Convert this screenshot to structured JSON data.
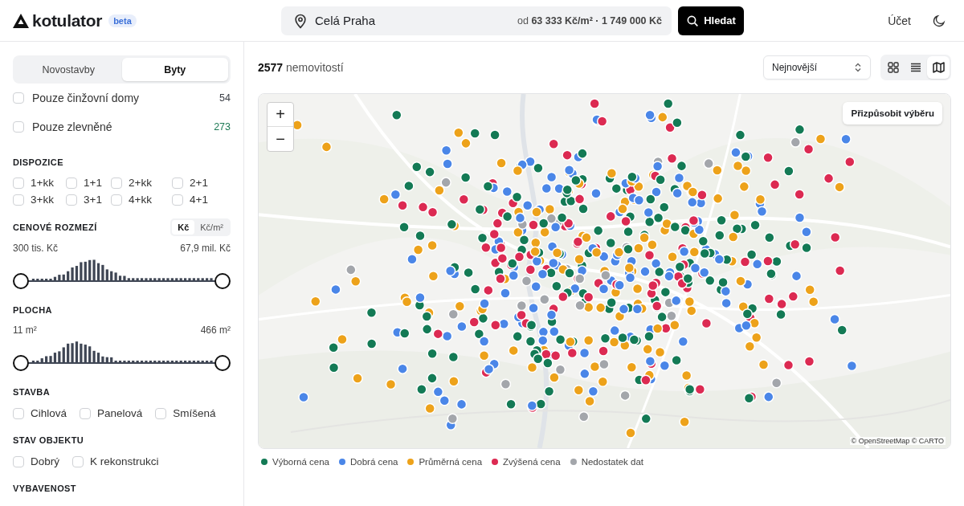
{
  "header": {
    "logo": "kotulator",
    "badge": "beta",
    "search": {
      "value": "Celá Praha",
      "price_info": "od **63 333 Kč/m² · 1 749 000 Kč**"
    },
    "search_button": "Hledat",
    "account": "Účet"
  },
  "sidebar": {
    "tabs": [
      {
        "label": "Novostavby",
        "selected": false
      },
      {
        "label": "Byty",
        "selected": true
      }
    ],
    "toggles": [
      {
        "label": "Pouze činžovní domy",
        "count": "54",
        "checked": false,
        "color": "#3b3f46"
      },
      {
        "label": "Pouze zlevněné",
        "count": "273",
        "checked": false,
        "color": "#1d7a55"
      }
    ],
    "sections": [
      {
        "kind": "grid",
        "title": "DISPOZICE",
        "options": [
          {
            "label": "1+kk",
            "checked": false
          },
          {
            "label": "1+1",
            "checked": false
          },
          {
            "label": "2+kk",
            "checked": false
          },
          {
            "label": "2+1",
            "checked": false
          },
          {
            "label": "3+kk",
            "checked": false
          },
          {
            "label": "3+1",
            "checked": false
          },
          {
            "label": "4+kk",
            "checked": false
          },
          {
            "label": "4+1",
            "checked": false
          }
        ]
      },
      {
        "kind": "range",
        "title": "CENOVÉ ROZMEZÍ",
        "units": [
          {
            "label": "Kč",
            "selected": true
          },
          {
            "label": "Kč/m²",
            "selected": false
          }
        ],
        "min_label": "300 tis. Kč",
        "max_label": "67,9 mil. Kč",
        "thumbs": [
          {
            "level": 0
          },
          {
            "level": 1
          }
        ]
      },
      {
        "kind": "range",
        "title": "PLOCHA",
        "min_label": "11 m²",
        "max_label": "466 m²",
        "thumbs": [
          {
            "level": 0
          },
          {
            "level": 1
          }
        ]
      },
      {
        "kind": "row",
        "title": "STAVBA",
        "options": [
          {
            "label": "Cihlová",
            "checked": false
          },
          {
            "label": "Panelová",
            "checked": false
          },
          {
            "label": "Smíšená",
            "checked": false
          }
        ]
      },
      {
        "kind": "row",
        "title": "STAV OBJEKTU",
        "options": [
          {
            "label": "Dobrý",
            "checked": false
          },
          {
            "label": "K rekonstrukci",
            "checked": false
          }
        ]
      },
      {
        "kind": "heading",
        "title": "VYBAVENOST"
      }
    ]
  },
  "main": {
    "result_count": "**2577** nemovitostí",
    "sort": "Nejnovější",
    "views": [
      {
        "kind": "grid",
        "selected": false
      },
      {
        "kind": "list",
        "selected": false
      },
      {
        "kind": "map",
        "selected": true
      }
    ],
    "map": {
      "zoom_in": "+",
      "zoom_out": "−",
      "fit_button": "Přizpůsobit výběru",
      "attribution": "© OpenStreetMap © CARTO",
      "legend": [
        {
          "label": "Výborná cena",
          "color": "#137a55"
        },
        {
          "label": "Dobrá cena",
          "color": "#4a86e8"
        },
        {
          "label": "Průměrná cena",
          "color": "#eda21a"
        },
        {
          "label": "Zvýšená cena",
          "color": "#dc2a52"
        },
        {
          "label": "Nedostatek dat",
          "color": "#a3a6ab"
        }
      ]
    }
  }
}
